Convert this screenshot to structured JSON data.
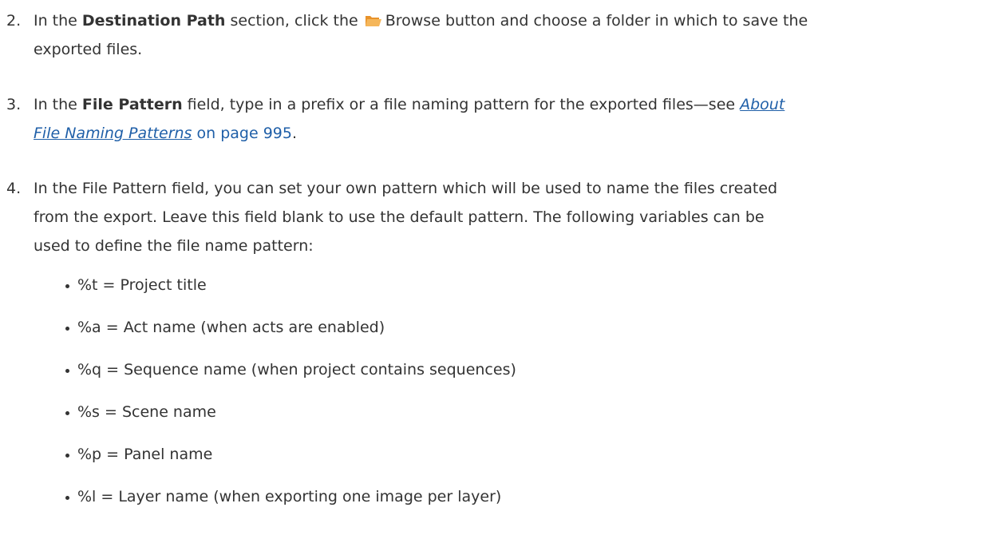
{
  "steps": [
    {
      "number": "2.",
      "pre": "In the ",
      "bold": "Destination Path",
      "mid": " section, click the ",
      "button_label": "Browse",
      "post_line1": " button and choose a folder in which to save the",
      "post_line2": "exported files.",
      "icon": "folder-open-icon"
    },
    {
      "number": "3.",
      "pre": "In the ",
      "bold": "File Pattern",
      "mid": " field, type in a prefix or a file naming pattern for the exported files—see ",
      "link_text_line1": "About",
      "link_text_line2": "File Naming Patterns",
      "link_suffix": " on page 995",
      "end": "."
    },
    {
      "number": "4.",
      "line1": "In the File Pattern field, you can set your own pattern which will be used to name the files created",
      "line2": "from the export. Leave this field blank to use the default pattern. The following variables can be",
      "line3": "used to define the file name pattern:"
    }
  ],
  "variables": [
    "%t = Project title",
    "%a = Act name (when acts are enabled)",
    "%q = Sequence name (when project contains sequences)",
    "%s = Scene name",
    "%p = Panel name",
    "%l = Layer name (when exporting one image per layer)"
  ],
  "colors": {
    "text": "#333333",
    "link": "#1f5fa8",
    "folder": "#f2a33a"
  }
}
